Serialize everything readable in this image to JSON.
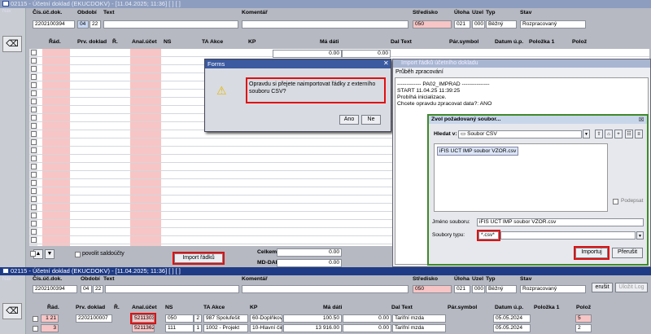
{
  "top_win": {
    "title": "02115 - Účetní doklad (EKUCDOKV) - [11.04.2025; 11:36] [ ] [ ]",
    "nav": "Nav",
    "labels": {
      "doc": "Čís.úč.dok.",
      "period": "Období",
      "text": "Text",
      "comment": "Komentář",
      "center": "Středisko",
      "task": "Úloha",
      "unit": "Uzel",
      "type": "Typ",
      "status": "Stav"
    },
    "values": {
      "doc": "2202100394",
      "p1": "04",
      "p2": "22",
      "center": "050",
      "task": "021",
      "unit": "000",
      "type": "Běžný",
      "status": "Rozpracovaný"
    },
    "cols": [
      "Řád.",
      "Prv. doklad",
      "Ř.",
      "Anal.účet",
      "NS",
      "TA Akce",
      "KP",
      "Má dáti",
      "Dal Text",
      "Pár.symbol",
      "Datum ú.p.",
      "Položka 1",
      "Polož"
    ],
    "first_md": "0.00",
    "first_dal": "0.00",
    "footer": {
      "povolit": "povolit saldoúčty",
      "import": "Import řádků",
      "celkem": "Celkem",
      "md_dal": "MD-DAL",
      "celkem_v": "0.00",
      "md_dal_v": "0.00"
    }
  },
  "forms": {
    "title": "Forms",
    "message": "Opravdu si přejete naimportovat řádky z externího souboru CSV?",
    "ano": "Ano",
    "ne": "Ne"
  },
  "import_win": {
    "title": "Import řádků účetního dokladu",
    "header": "Průběh zpracování",
    "log": [
      "------------- PA02_IMPRAD ---------------",
      "START 11.04.25 11:39:25",
      "Probíhá inicializace.",
      "Chcete opravdu zpracovat data?: ANO"
    ]
  },
  "file_dlg": {
    "title": "Zvol požadovaný soubor...",
    "look_in": "Hledat v:",
    "folder": "Soubor CSV",
    "file": "iFIS UCT IMP soubor VZOR.csv",
    "sign": "Podepsat",
    "name_lbl": "Jméno souboru:",
    "name_val": "iFIS UCT IMP soubor VZOR.csv",
    "type_lbl": "Soubory typu:",
    "type_val": "*.csv*",
    "importuj": "Importuj",
    "prerusit": "Přerušit"
  },
  "bottom_win": {
    "title": "02115 - Účetní doklad (EKUCDOKV) - [11.04.2025; 11:36] [ ] [ ]",
    "values": {
      "doc": "2202100394",
      "p1": "04",
      "p2": "22",
      "center": "050",
      "task": "021",
      "unit": "000",
      "type": "Běžný",
      "status": "Rozpracovaný"
    },
    "cols": [
      "Řád.",
      "Prv. doklad",
      "Ř.",
      "Anal.účet",
      "NS",
      "TA Akce",
      "KP",
      "Má dáti",
      "Dal Text",
      "Pár.symbol",
      "Datum ú.p.",
      "Položka 1",
      "Polož"
    ],
    "rows": [
      {
        "r": "1",
        "n": "21",
        "doc": "2202100007",
        "ucet": "5211303",
        "ns": "050",
        "ta": "2",
        "akce": "987 Spolufešit",
        "kp": "60-Doplňkov",
        "md": "100.50",
        "dal": "0.00",
        "text": "Tarifní mzda",
        "date": "05.05.2024",
        "pol": "5"
      },
      {
        "r": "",
        "n": "3",
        "doc": "",
        "ucet": "5211362",
        "ns": "111",
        "ta": "1",
        "akce": "1002 - Projekt",
        "kp": "10-Hlavní čin",
        "md": "13 916.00",
        "dal": "0.00",
        "text": "Tarifní mzda",
        "date": "05.05.2024",
        "pol": "2"
      }
    ],
    "btn_erusit": "erušit",
    "btn_log": "Uložit Log"
  }
}
